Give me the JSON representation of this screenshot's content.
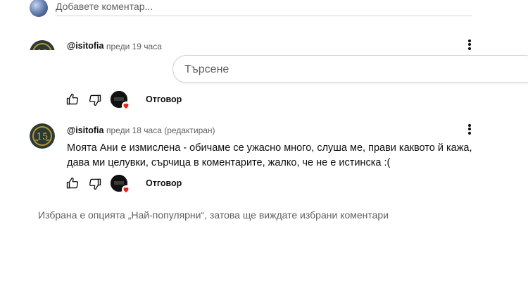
{
  "add_comment": {
    "placeholder": "Добавете коментар..."
  },
  "search": {
    "placeholder": "Търсене"
  },
  "comments": [
    {
      "author": "@isitofia",
      "time": "преди 19 часа",
      "reply_label": "Отговор"
    },
    {
      "author": "@isitofia",
      "time": "преди 18 часа (редактиран)",
      "text_line1": "Моята Ани е измислена - обичаме се ужасно много, слуша ме, прави каквото й кажа,",
      "text_line2": "дава ми целувки, сърчица в коментарите, жалко, че не е истинска :(",
      "reply_label": "Отговор"
    }
  ],
  "footer_note": "Избрана е опцията „Най-популярни“, затова ще виждате избрани коментари",
  "colors": {
    "accent_heart": "#e62117",
    "muted_text": "#606060"
  },
  "icons": [
    "avatar",
    "more-vert-icon",
    "thumb-up-icon",
    "thumb-down-icon",
    "creator-heart-icon"
  ]
}
